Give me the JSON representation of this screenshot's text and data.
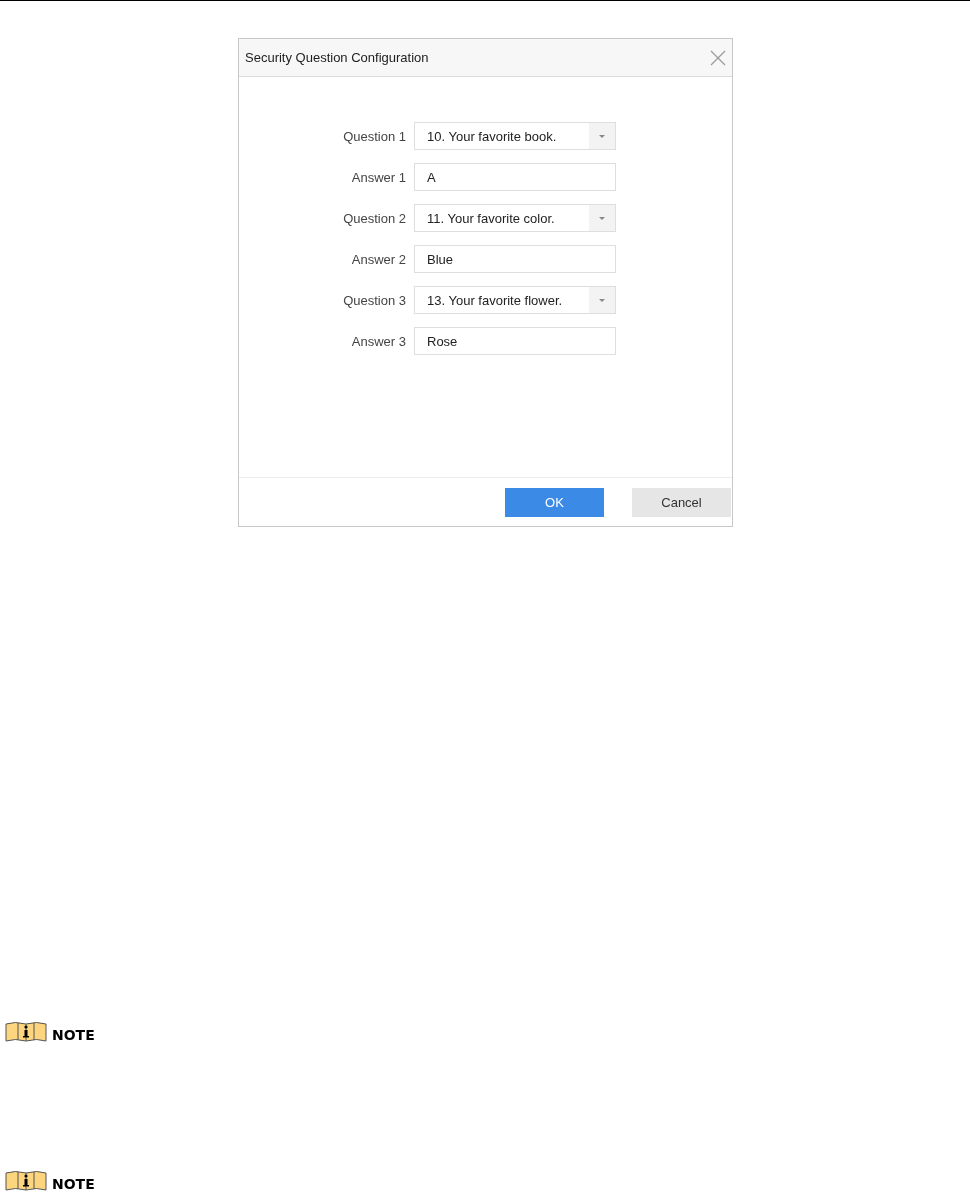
{
  "dialog": {
    "title": "Security Question Configuration",
    "fields": [
      {
        "kind": "select",
        "label": "Question 1",
        "value": "10. Your favorite book."
      },
      {
        "kind": "text",
        "label": "Answer 1",
        "value": "A"
      },
      {
        "kind": "select",
        "label": "Question 2",
        "value": "11. Your favorite color."
      },
      {
        "kind": "text",
        "label": "Answer 2",
        "value": "Blue"
      },
      {
        "kind": "select",
        "label": "Question 3",
        "value": "13. Your favorite flower."
      },
      {
        "kind": "text",
        "label": "Answer 3",
        "value": "Rose"
      }
    ],
    "buttons": [
      {
        "kind": "primary",
        "label": "OK"
      },
      {
        "kind": "secondary",
        "label": "Cancel"
      }
    ]
  },
  "notes": [
    {
      "label": "NOTE"
    },
    {
      "label": "NOTE"
    }
  ]
}
